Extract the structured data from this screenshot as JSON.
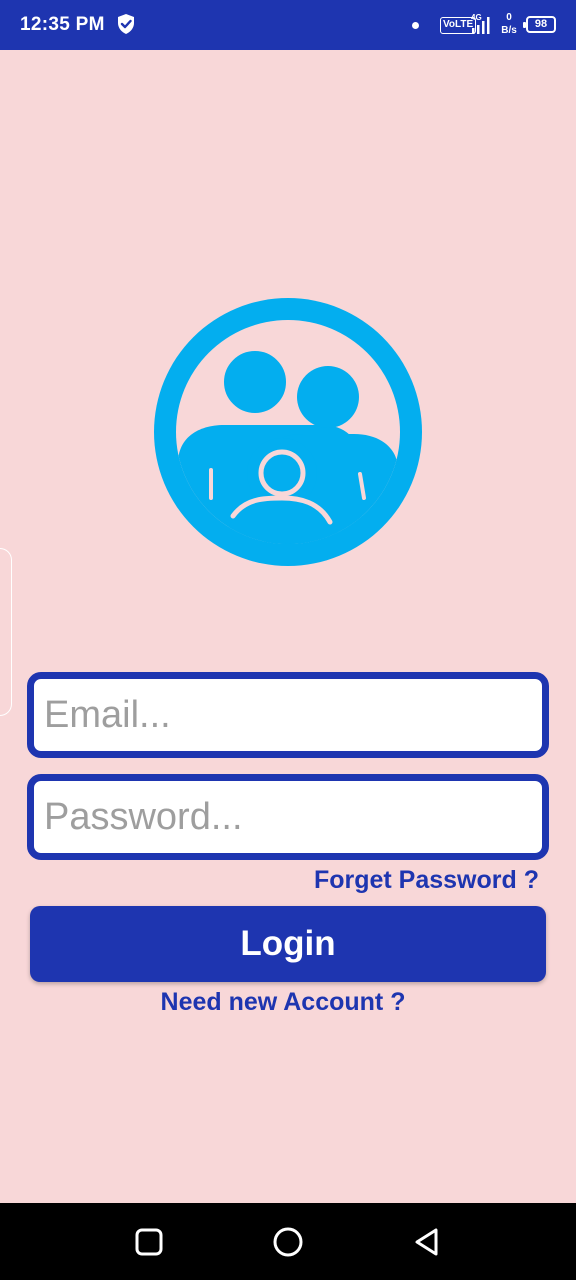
{
  "status_bar": {
    "time": "12:35 PM",
    "volte": "VoLTE",
    "network": "4G",
    "net_speed_value": "0",
    "net_speed_unit": "B/s",
    "battery": "98",
    "icons": [
      "shield-check-icon",
      "notification-dot-icon",
      "signal-icon",
      "battery-icon"
    ]
  },
  "login": {
    "logo_icon": "family-group-icon",
    "email_placeholder": "Email...",
    "email_value": "",
    "password_placeholder": "Password...",
    "password_value": "",
    "forget_label": "Forget Password ?",
    "login_label": "Login",
    "signup_label": "Need new Account ?"
  },
  "nav_bar": {
    "icons": [
      "recents-icon",
      "home-icon",
      "back-icon"
    ]
  },
  "colors": {
    "background": "#f8d7d8",
    "primary": "#1e35b0",
    "logo": "#03aeef",
    "nav_bar": "#000000"
  }
}
